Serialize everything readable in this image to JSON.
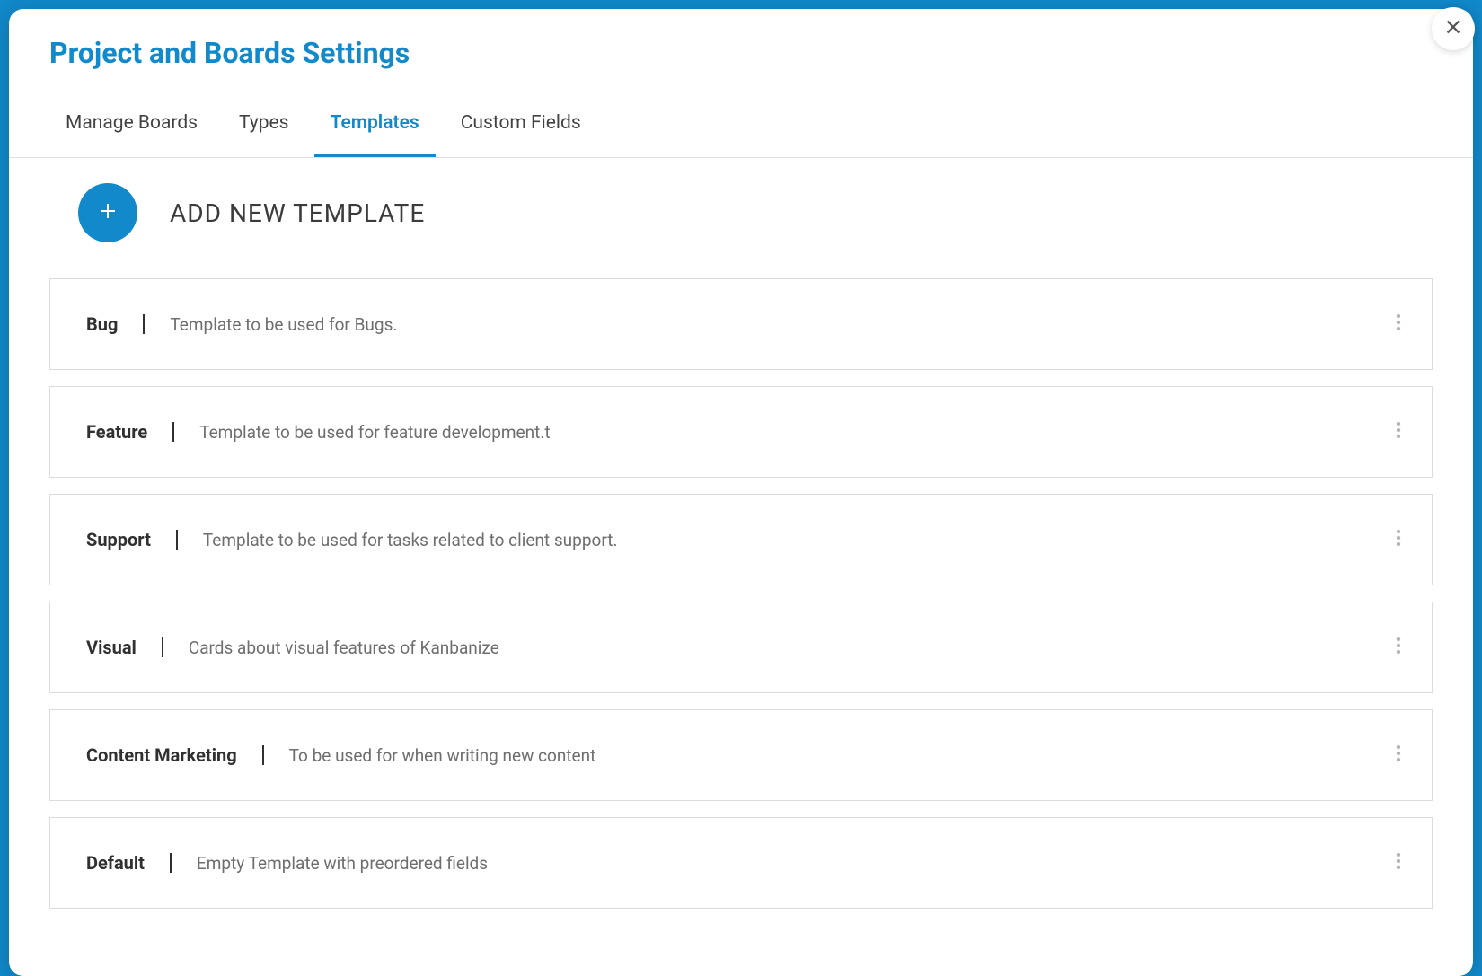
{
  "header": {
    "title": "Project and Boards Settings"
  },
  "tabs": [
    {
      "label": "Manage Boards",
      "active": false
    },
    {
      "label": "Types",
      "active": false
    },
    {
      "label": "Templates",
      "active": true
    },
    {
      "label": "Custom Fields",
      "active": false
    }
  ],
  "addSection": {
    "label": "ADD NEW TEMPLATE"
  },
  "templates": [
    {
      "name": "Bug",
      "description": "Template to be used for Bugs."
    },
    {
      "name": "Feature",
      "description": "Template to be used for feature development.t"
    },
    {
      "name": "Support",
      "description": "Template to be used for tasks related to client support."
    },
    {
      "name": "Visual",
      "description": "Cards about visual features of Kanbanize"
    },
    {
      "name": "Content Marketing",
      "description": "To be used for when writing new content"
    },
    {
      "name": "Default",
      "description": "Empty Template with preordered fields"
    }
  ]
}
